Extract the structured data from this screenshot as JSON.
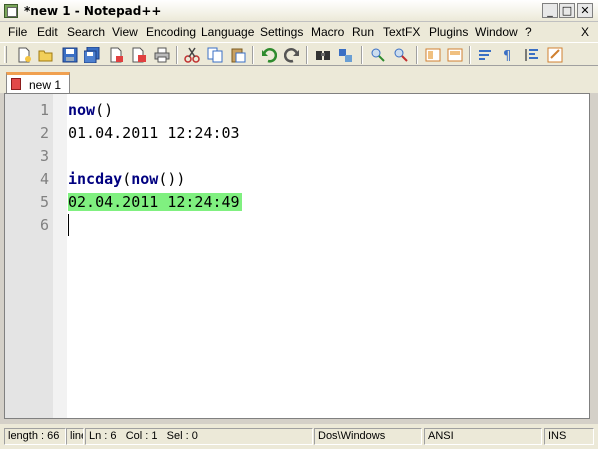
{
  "window": {
    "title": "*new  1 - Notepad++",
    "minimize_label": "_",
    "maximize_label": "□",
    "close_label": "✕"
  },
  "menu": {
    "items": [
      "File",
      "Edit",
      "Search",
      "View",
      "Encoding",
      "Language",
      "Settings",
      "Macro",
      "Run",
      "TextFX",
      "Plugins",
      "Window",
      "?"
    ],
    "close_doc": "X"
  },
  "toolbar": {
    "icons": [
      "new-file-icon",
      "open-file-icon",
      "save-icon",
      "save-all-icon",
      "close-icon",
      "close-all-icon",
      "print-icon",
      "cut-icon",
      "copy-icon",
      "paste-icon",
      "undo-icon",
      "redo-icon",
      "find-icon",
      "replace-icon",
      "zoom-in-icon",
      "zoom-out-icon",
      "sync-vertical-icon",
      "sync-horizontal-icon",
      "word-wrap-icon",
      "show-all-chars-icon",
      "indent-guide-icon",
      "user-define-icon"
    ]
  },
  "tabs": [
    {
      "label": "new  1",
      "active": true
    }
  ],
  "editor": {
    "line_numbers": [
      "1",
      "2",
      "3",
      "4",
      "5",
      "6"
    ],
    "lines": [
      {
        "text": "now()",
        "keyword": "now",
        "rest": "()"
      },
      {
        "text": "01.04.2011 12:24:03"
      },
      {
        "text": ""
      },
      {
        "text": "incday(now())",
        "keyword": "incday",
        "rest1": "(",
        "keyword2": "now",
        "rest2": "())"
      },
      {
        "text": "02.04.2011 12:24:49",
        "highlighted": true
      },
      {
        "text": ""
      }
    ],
    "highlight_color": "#80f080",
    "keyword_color": "#000080"
  },
  "status": {
    "length": "length : 66",
    "lines": "line",
    "ln": "Ln : 6",
    "col": "Col : 1",
    "sel": "Sel : 0",
    "eol": "Dos\\Windows",
    "encoding": "ANSI",
    "mode": "INS"
  }
}
